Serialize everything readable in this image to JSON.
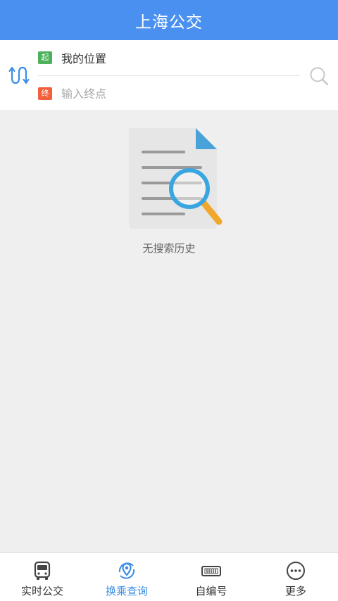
{
  "header": {
    "title": "上海公交"
  },
  "route": {
    "start_badge": "起",
    "start_label": "我的位置",
    "end_badge": "终",
    "end_placeholder": "输入终点",
    "end_value": ""
  },
  "empty_state": {
    "message": "无搜索历史"
  },
  "tabs": [
    {
      "label": "实时公交",
      "icon": "bus-icon"
    },
    {
      "label": "换乘查询",
      "icon": "route-pin-icon",
      "active": true
    },
    {
      "label": "自编号",
      "icon": "vehicle-number-icon"
    },
    {
      "label": "更多",
      "icon": "more-dots-icon"
    }
  ],
  "colors": {
    "header_bg": "#4a90f0",
    "active_tab": "#3a8ee6",
    "start_badge": "#4cb15a",
    "end_badge": "#f2603c",
    "background": "#efefef"
  }
}
